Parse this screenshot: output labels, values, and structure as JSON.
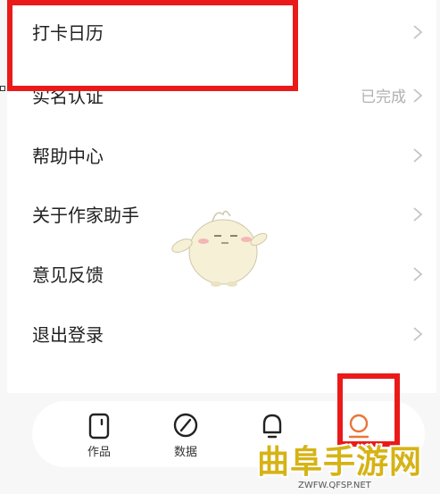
{
  "menu": {
    "items": [
      {
        "label": "打卡日历",
        "status": ""
      },
      {
        "label": "实名认证",
        "status": "已完成"
      },
      {
        "label": "帮助中心",
        "status": ""
      },
      {
        "label": "关于作家助手",
        "status": ""
      },
      {
        "label": "意见反馈",
        "status": ""
      },
      {
        "label": "退出登录",
        "status": ""
      }
    ]
  },
  "tabbar": {
    "tabs": [
      {
        "label": "作品",
        "icon": "works-icon"
      },
      {
        "label": "数据",
        "icon": "data-icon"
      },
      {
        "label": "",
        "icon": "bell-icon"
      },
      {
        "label": "",
        "icon": "profile-icon",
        "active": true
      }
    ]
  },
  "watermark": {
    "main": "曲阜手游网",
    "sub": "ZWFW.QFSP.NET"
  },
  "colors": {
    "highlight": "#ea1a1a",
    "accent": "#e8763a",
    "watermark": "#d6b316"
  }
}
